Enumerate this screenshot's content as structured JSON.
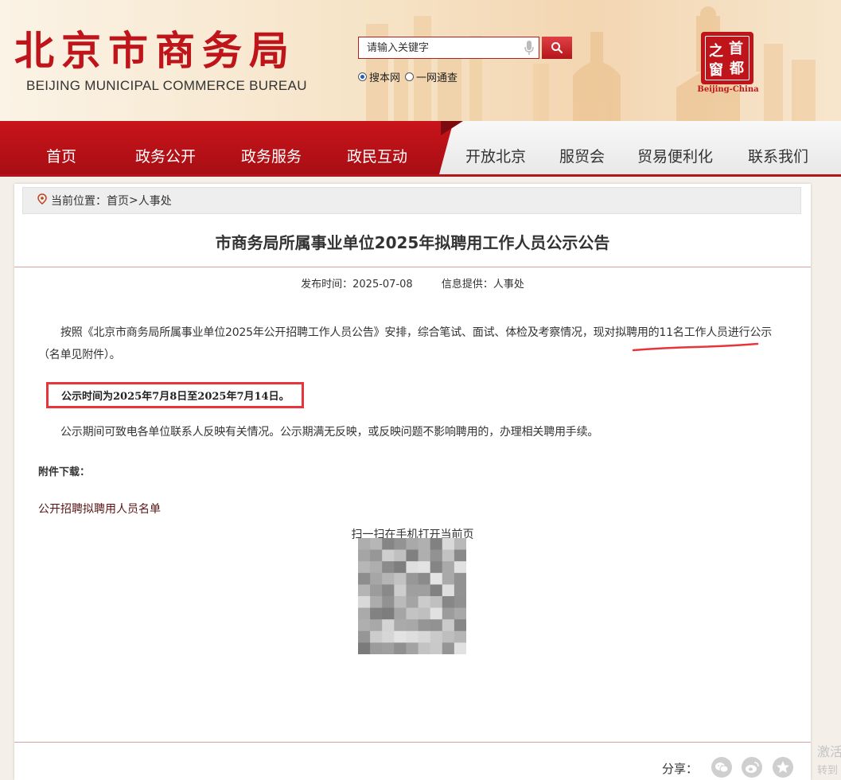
{
  "header": {
    "logo_cn": "北京市商务局",
    "logo_en": "BEIJING MUNICIPAL COMMERCE BUREAU",
    "search_placeholder": "请输入关键字",
    "scope_options": [
      "搜本网",
      "一网通查"
    ],
    "seal_chars": [
      "之",
      "首",
      "窗",
      "都"
    ],
    "seal_caption": "Beijing-China"
  },
  "nav": {
    "primary": [
      "首页",
      "政务公开",
      "政务服务",
      "政民互动"
    ],
    "secondary": [
      "开放北京",
      "服贸会",
      "贸易便利化",
      "联系我们"
    ]
  },
  "breadcrumb": {
    "prefix": "当前位置：",
    "home": "首页",
    "separator": ">",
    "current": "人事处"
  },
  "article": {
    "title": "市商务局所属事业单位2025年拟聘用工作人员公示公告",
    "publish_label": "发布时间：",
    "publish_date": "2025-07-08",
    "source_label": "信息提供：",
    "source": "人事处",
    "paragraph1": "按照《北京市商务局所属事业单位2025年公开招聘工作人员公告》安排，综合笔试、面试、体检及考察情况，现对拟聘用的11名工作人员进行公示（名单见附件）。",
    "notice_period": "公示时间为2025年7月8日至2025年7月14日。",
    "paragraph3": "公示期间可致电各单位联系人反映有关情况。公示期满无反映，或反映问题不影响聘用的，办理相关聘用手续。",
    "attachment_label": "附件下载：",
    "attachment_name": "公开招聘拟聘用人员名单",
    "qr_caption": "扫一扫在手机打开当前页"
  },
  "share": {
    "label": "分享：",
    "targets": [
      "wechat-icon",
      "weibo-icon",
      "favorite-icon"
    ]
  },
  "watermark": [
    "激活",
    "转到"
  ],
  "colors": {
    "brand_red": "#c0141b",
    "nav_red": "#b0161c",
    "highlight_box": "#e8343b",
    "scope_radio": "#1b5fbf"
  }
}
